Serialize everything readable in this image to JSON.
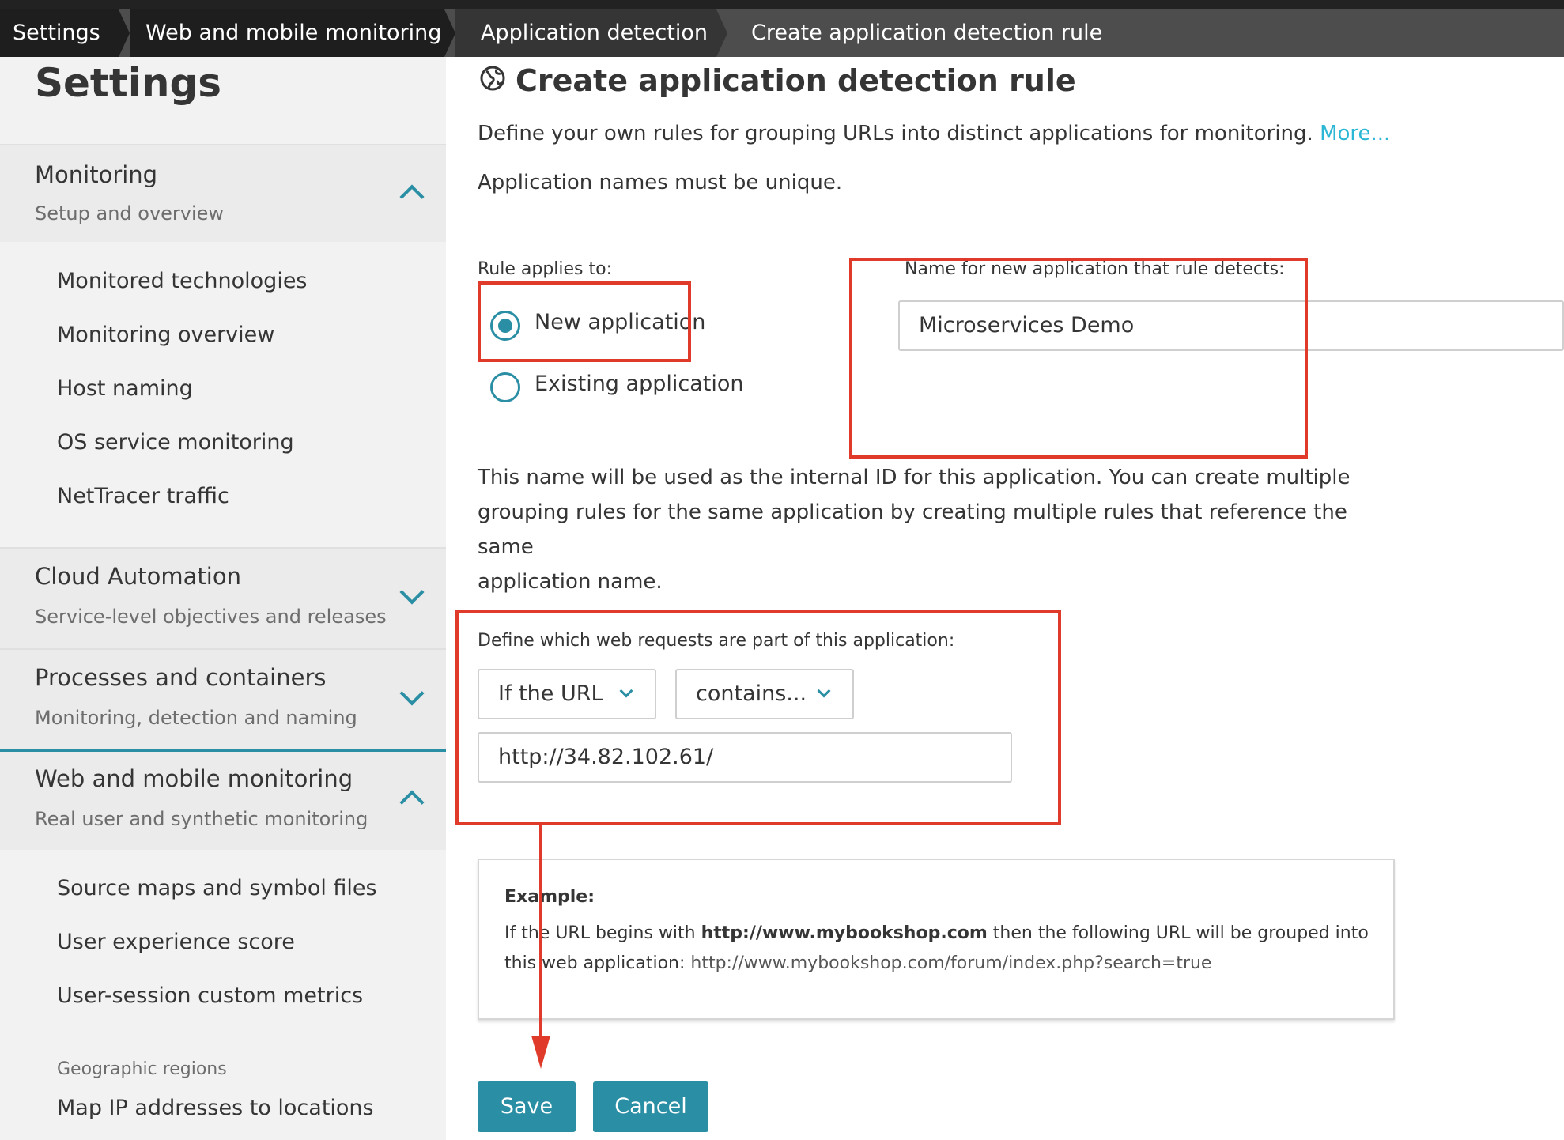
{
  "breadcrumb": [
    "Settings",
    "Web and mobile monitoring",
    "Application detection",
    "Create application detection rule"
  ],
  "sidebar": {
    "title": "Settings",
    "monitoring": {
      "name": "Monitoring",
      "sub": "Setup and overview",
      "items": [
        "Monitored technologies",
        "Monitoring overview",
        "Host naming",
        "OS service monitoring",
        "NetTracer traffic"
      ]
    },
    "cloud": {
      "name": "Cloud Automation",
      "sub": "Service-level objectives and releases"
    },
    "processes": {
      "name": "Processes and containers",
      "sub": "Monitoring, detection and naming"
    },
    "web": {
      "name": "Web and mobile monitoring",
      "sub": "Real user and synthetic monitoring",
      "items": [
        "Source maps and symbol files",
        "User experience score",
        "User-session custom metrics"
      ],
      "group_label": "Geographic regions",
      "group_items": [
        "Map IP addresses to locations"
      ]
    }
  },
  "main": {
    "title": "Create application detection rule",
    "intro": "Define your own rules for grouping URLs into distinct applications for monitoring.",
    "more_link": "More...",
    "unique_note": "Application names must be unique.",
    "rule_applies_label": "Rule applies to:",
    "radio_new": "New application",
    "radio_existing": "Existing application",
    "selected_radio": "New application",
    "name_label": "Name for new application that rule detects:",
    "name_value": "Microservices Demo",
    "explanation_line1": "This name will be used as the internal ID for this application. You can create multiple",
    "explanation_line2": "grouping rules for the same application by creating multiple rules that reference the same",
    "explanation_line3": "application name.",
    "define_label": "Define which web requests are part of this application:",
    "condition_field": "If the URL",
    "condition_operator": "contains...",
    "condition_value": "http://34.82.102.61/",
    "example": {
      "title": "Example:",
      "line1_a": "If the URL begins with ",
      "line1_b": "http://www.mybookshop.com",
      "line1_c": " then the following URL will be grouped into",
      "line2_a": "this web application: ",
      "line2_b": "http://www.mybookshop.com/forum/index.php?search=true"
    },
    "save": "Save",
    "cancel": "Cancel"
  },
  "colors": {
    "accent": "#2a8ea4",
    "link": "#2ab6d4",
    "annotation": "#e03a2a"
  },
  "icons": [
    "globe-icon",
    "chevron-up-icon",
    "chevron-down-icon",
    "radio-selected-icon",
    "radio-unselected-icon"
  ]
}
